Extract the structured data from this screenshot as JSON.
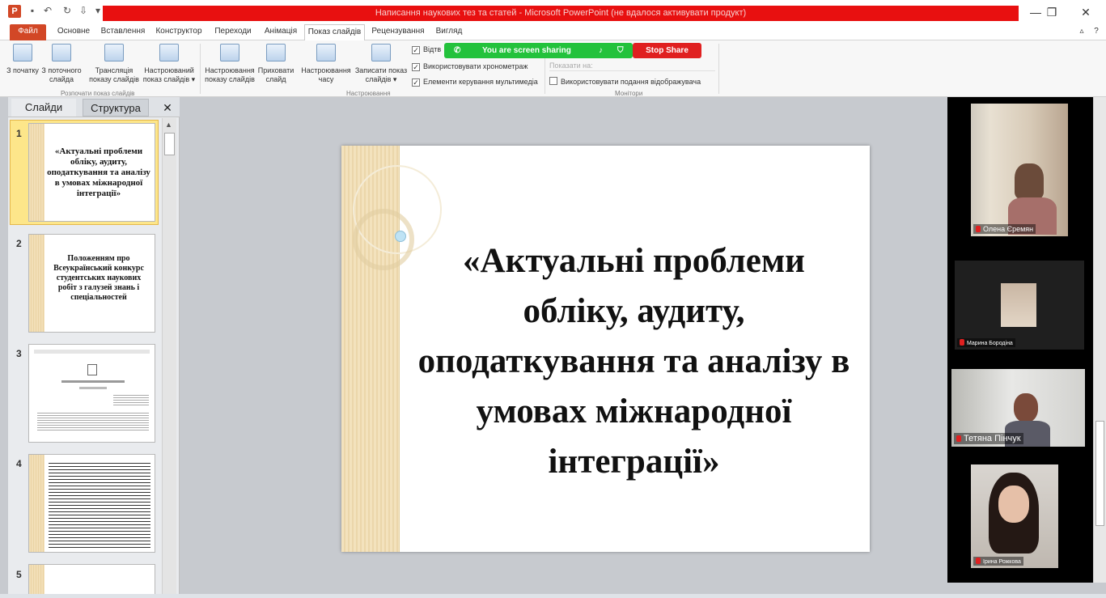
{
  "window": {
    "title": "Написання наукових тез та статей - Microsoft PowerPoint (не вдалося активувати продукт)",
    "app_letter": "P"
  },
  "tabs": [
    {
      "label": "Файл"
    },
    {
      "label": "Основне"
    },
    {
      "label": "Вставлення"
    },
    {
      "label": "Конструктор"
    },
    {
      "label": "Переходи"
    },
    {
      "label": "Анімація"
    },
    {
      "label": "Показ слайдів"
    },
    {
      "label": "Рецензування"
    },
    {
      "label": "Вигляд"
    }
  ],
  "ribbon": {
    "buttons": [
      {
        "label": "З початку"
      },
      {
        "label": "З поточного слайда"
      },
      {
        "label": "Трансляція показу слайдів"
      },
      {
        "label": "Настроюваний показ слайдів ▾"
      },
      {
        "label": "Настроювання показу слайдів"
      },
      {
        "label": "Приховати слайд"
      },
      {
        "label": "Настроювання часу"
      },
      {
        "label": "Записати показ слайдів ▾"
      }
    ],
    "groups": [
      {
        "label": "Розпочати показ слайдів"
      },
      {
        "label": "Настроювання"
      },
      {
        "label": "Монітори"
      }
    ],
    "checkboxes": [
      {
        "label": "Відтв",
        "checked": "✓"
      },
      {
        "label": "Використовувати хронометраж",
        "checked": "✓"
      },
      {
        "label": "Елементи керування мультимедіа",
        "checked": "✓"
      },
      {
        "label": "Використовувати подання відображувача",
        "checked": ""
      }
    ],
    "show_on": "Показати на:"
  },
  "share": {
    "status": "You are screen sharing",
    "stop": "Stop Share"
  },
  "panel": {
    "tab_slides": "Слайди",
    "tab_outline": "Структура",
    "close": "✕"
  },
  "slides": [
    {
      "num": "1",
      "text": "«Актуальні проблеми обліку, аудиту, оподаткування та аналізу в умовах міжнародної інтеграції»"
    },
    {
      "num": "2",
      "text": "Положенням про Всеукраїнський конкурс студентських наукових робіт з галузей знань і спеціальностей"
    },
    {
      "num": "3",
      "text": ""
    },
    {
      "num": "4",
      "text": ""
    },
    {
      "num": "5",
      "text": ""
    }
  ],
  "main_slide": {
    "title": "«Актуальні проблеми обліку, аудиту, оподаткування та аналізу в умовах міжнародної інтеграції»"
  },
  "participants": [
    {
      "name": "Олена Єремян"
    },
    {
      "name": "Марина Бородіна"
    },
    {
      "name": "Тетяна Пінчук"
    },
    {
      "name": "Ірина Рожкова"
    }
  ],
  "colors": {
    "file_tab": "#d24726",
    "title_highlight": "#e81010",
    "share_green": "#23c23c",
    "stop_red": "#e02020"
  }
}
